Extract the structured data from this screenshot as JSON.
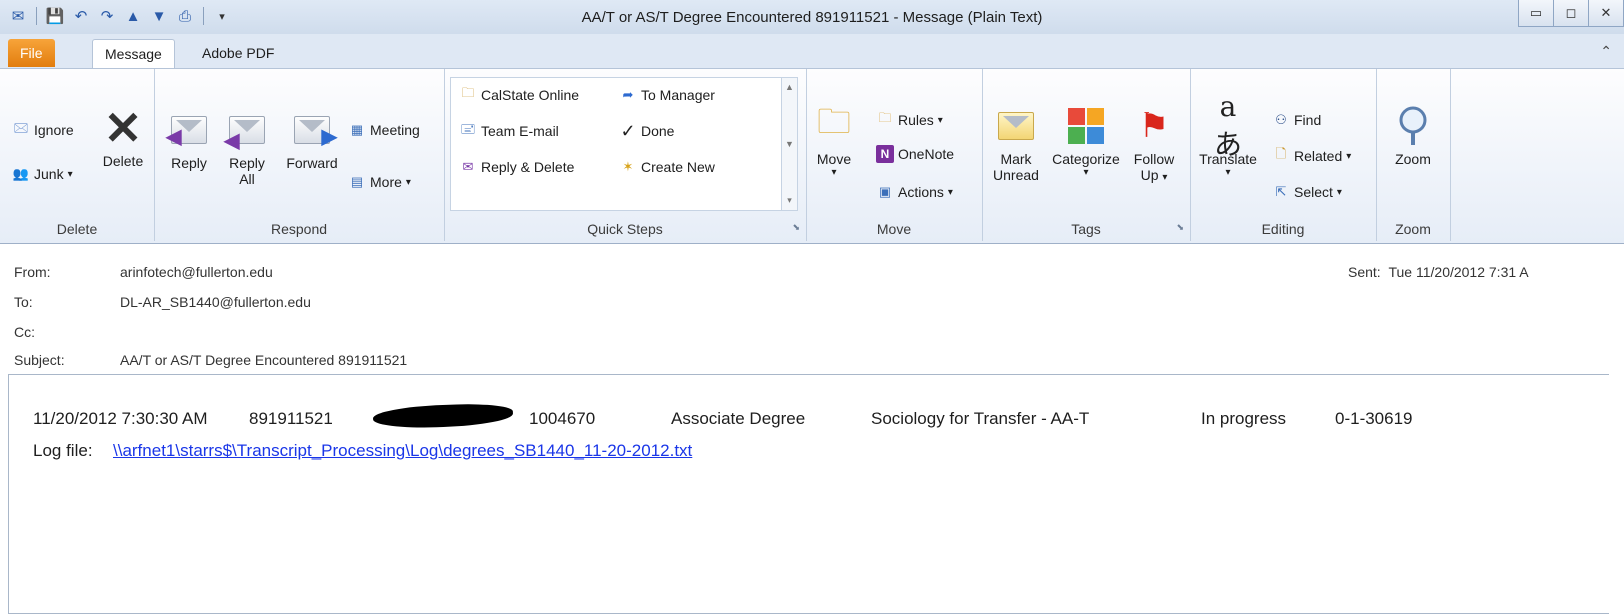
{
  "window": {
    "title": "AA/T or AS/T Degree Encountered 891911521  -  Message (Plain Text)"
  },
  "tabs": [
    {
      "label": "File"
    },
    {
      "label": "Message"
    },
    {
      "label": "Adobe PDF"
    }
  ],
  "ribbon": {
    "delete_group": {
      "label": "Delete",
      "ignore": "Ignore",
      "junk": "Junk",
      "delete": "Delete"
    },
    "respond_group": {
      "label": "Respond",
      "reply": "Reply",
      "reply_all_1": "Reply",
      "reply_all_2": "All",
      "forward": "Forward",
      "meeting": "Meeting",
      "more": "More"
    },
    "quick_steps": {
      "label": "Quick Steps",
      "items": [
        "CalState Online",
        "Team E-mail",
        "Reply & Delete",
        "To Manager",
        "Done",
        "Create New"
      ]
    },
    "move_group": {
      "label": "Move",
      "move": "Move",
      "rules": "Rules",
      "onenote": "OneNote",
      "actions": "Actions"
    },
    "tags_group": {
      "label": "Tags",
      "mark_unread_1": "Mark",
      "mark_unread_2": "Unread",
      "categorize": "Categorize",
      "follow_up_1": "Follow",
      "follow_up_2": "Up"
    },
    "editing_group": {
      "label": "Editing",
      "translate": "Translate",
      "find": "Find",
      "related": "Related",
      "select": "Select"
    },
    "zoom_group": {
      "label": "Zoom",
      "zoom": "Zoom"
    }
  },
  "header": {
    "from_label": "From:",
    "from": "arinfotech@fullerton.edu",
    "to_label": "To:",
    "to": "DL-AR_SB1440@fullerton.edu",
    "cc_label": "Cc:",
    "cc": "",
    "subject_label": "Subject:",
    "subject": "AA/T or AS/T Degree Encountered 891911521",
    "sent_label": "Sent:",
    "sent": "Tue 11/20/2012 7:31 A"
  },
  "body": {
    "timestamp": "11/20/2012 7:30:30 AM",
    "id": "891911521",
    "number": "1004670",
    "degree": "Associate Degree",
    "program": "Sociology for Transfer - AA-T",
    "status": "In progress",
    "code": "0-1-30619",
    "log_label": "Log file:",
    "log_path": "\\\\arfnet1\\starrs$\\Transcript_Processing\\Log\\degrees_SB1440_11-20-2012.txt"
  },
  "colors": {
    "file_tab": "#e8871e",
    "link": "#1a36e8",
    "ribbon_bg": "#e6edf7"
  }
}
